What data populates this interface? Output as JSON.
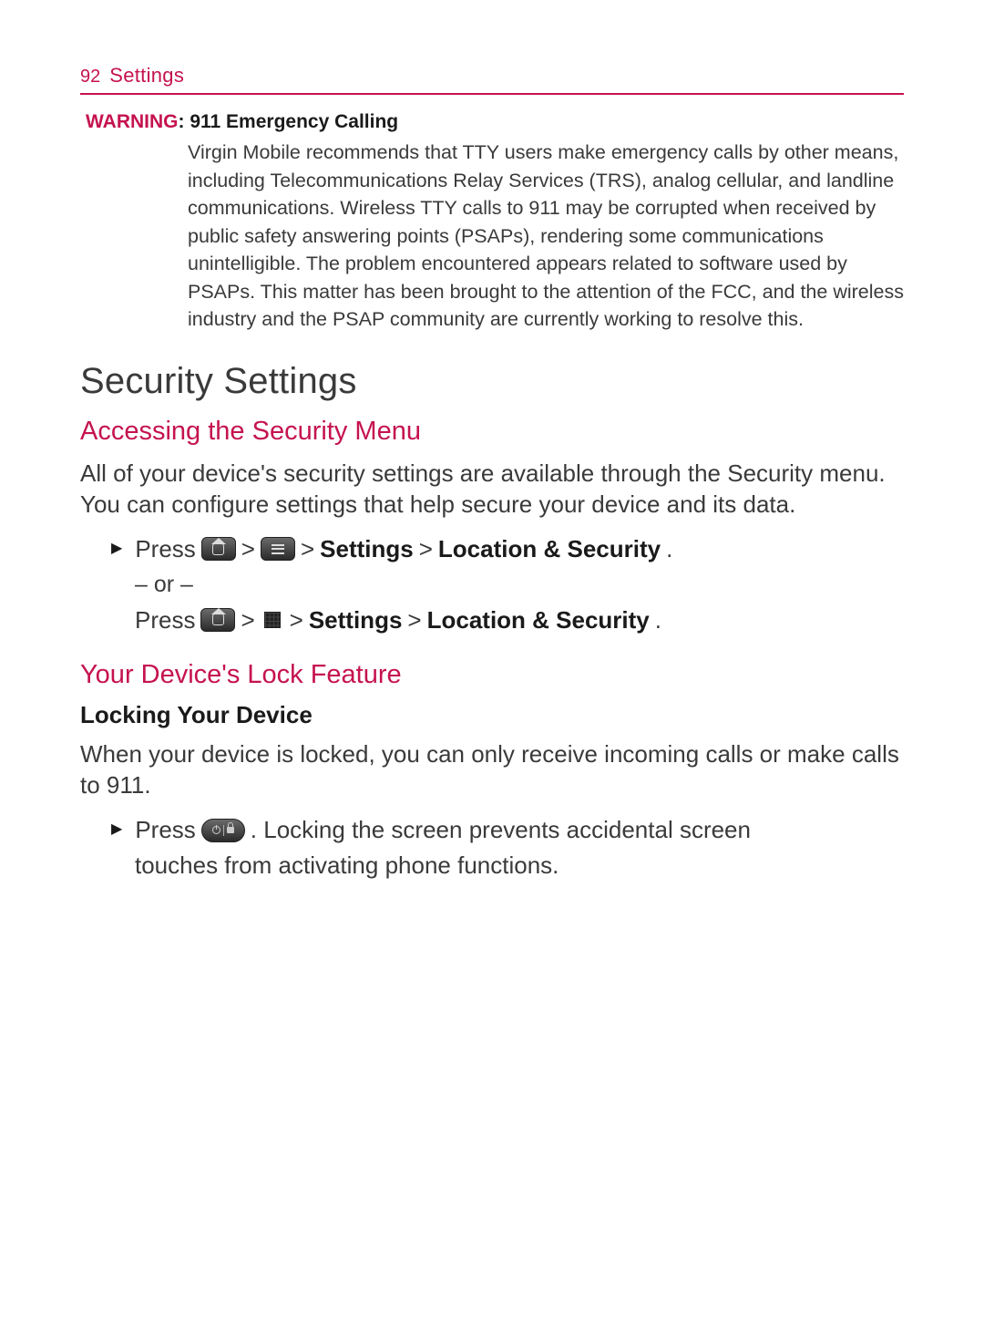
{
  "header": {
    "page_number": "92",
    "section": "Settings"
  },
  "warning": {
    "label": "WARNING",
    "title": "911 Emergency Calling",
    "body": "Virgin Mobile recommends that TTY users make emergency calls by other means, including Telecommunications Relay Services (TRS), analog cellular, and landline communications. Wireless TTY calls to 911 may be corrupted when received by public safety answering points (PSAPs), rendering some communications unintelligible. The problem encountered appears related to software used by PSAPs. This matter has been brought to the attention of the FCC, and the wireless industry and the PSAP community are currently working to resolve this."
  },
  "h1": "Security Settings",
  "section1": {
    "heading": "Accessing the Security Menu",
    "body": "All of your device's security settings are available through the Security menu. You can configure settings that help secure your device and its data.",
    "step": {
      "press": "Press",
      "gt": ">",
      "settings": "Settings",
      "location_security": "Location & Security",
      "period": ".",
      "or": "– or –"
    }
  },
  "section2": {
    "heading": "Your Device's Lock Feature",
    "sub_heading": "Locking Your Device",
    "body": "When your device is locked, you can only receive incoming calls or make calls to 911.",
    "step": {
      "press": "Press",
      "tail": ". Locking the screen prevents accidental screen",
      "cont": "touches from activating phone functions."
    }
  },
  "bullet": "▶"
}
